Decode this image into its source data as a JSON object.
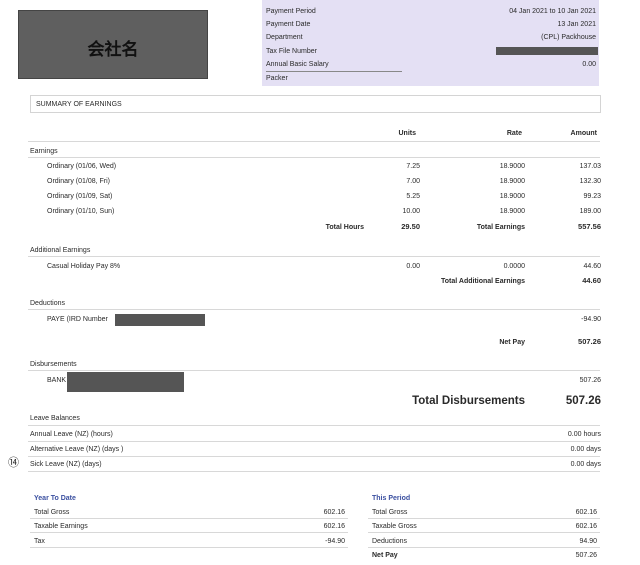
{
  "company": {
    "logo_text": "会社名"
  },
  "header": {
    "rows": [
      {
        "label": "Payment Period",
        "value": "04 Jan 2021 to 10 Jan 2021"
      },
      {
        "label": "Payment Date",
        "value": "13 Jan 2021"
      },
      {
        "label": "Department",
        "value": "(CPL) Packhouse"
      },
      {
        "label": "Tax File Number",
        "value": ""
      },
      {
        "label": "Annual Basic Salary",
        "value": "0.00"
      },
      {
        "label": "Packer",
        "value": ""
      }
    ]
  },
  "summary_title": "SUMMARY OF EARNINGS",
  "columns": {
    "units": "Units",
    "rate": "Rate",
    "amount": "Amount"
  },
  "earnings": {
    "title": "Earnings",
    "rows": [
      {
        "label": "Ordinary (01/06, Wed)",
        "units": "7.25",
        "rate": "18.9000",
        "amount": "137.03"
      },
      {
        "label": "Ordinary (01/08, Fri)",
        "units": "7.00",
        "rate": "18.9000",
        "amount": "132.30"
      },
      {
        "label": "Ordinary (01/09, Sat)",
        "units": "5.25",
        "rate": "18.9000",
        "amount": "99.23"
      },
      {
        "label": "Ordinary (01/10, Sun)",
        "units": "10.00",
        "rate": "18.9000",
        "amount": "189.00"
      }
    ],
    "total_hours_label": "Total Hours",
    "total_hours": "29.50",
    "total_earnings_label": "Total Earnings",
    "total_earnings": "557.56"
  },
  "additional": {
    "title": "Additional Earnings",
    "row": {
      "label": "Casual Holiday Pay 8%",
      "units": "0.00",
      "rate": "0.0000",
      "amount": "44.60"
    },
    "total_label": "Total Additional Earnings",
    "total": "44.60"
  },
  "deductions": {
    "title": "Deductions",
    "row": {
      "label": "PAYE (IRD Number",
      "amount": "-94.90"
    },
    "net_pay_label": "Net Pay",
    "net_pay": "507.26"
  },
  "disbursements": {
    "title": "Disbursements",
    "row": {
      "label": "BANK",
      "amount": "507.26"
    },
    "total_label": "Total Disbursements",
    "total": "507.26"
  },
  "leave": {
    "title": "Leave Balances",
    "marker": "⑭",
    "rows": [
      {
        "label": "Annual Leave (NZ) (hours)",
        "value": "0.00 hours"
      },
      {
        "label": "Alternative Leave (NZ) (days )",
        "value": "0.00 days"
      },
      {
        "label": "Sick Leave (NZ) (days)",
        "value": "0.00 days"
      }
    ]
  },
  "ytd": {
    "title": "Year To Date",
    "rows": [
      {
        "label": "Total Gross",
        "value": "602.16"
      },
      {
        "label": "Taxable Earnings",
        "value": "602.16"
      },
      {
        "label": "Tax",
        "value": "-94.90"
      }
    ]
  },
  "this_period": {
    "title": "This Period",
    "rows": [
      {
        "label": "Total Gross",
        "value": "602.16"
      },
      {
        "label": "Taxable Gross",
        "value": "602.16"
      },
      {
        "label": "Deductions",
        "value": "94.90"
      },
      {
        "label": "Net Pay",
        "value": "507.26"
      }
    ]
  },
  "colors": {
    "header_bg": "#e4e0f4",
    "redaction": "#555555",
    "section_title_blue": "#3a4fa0"
  }
}
